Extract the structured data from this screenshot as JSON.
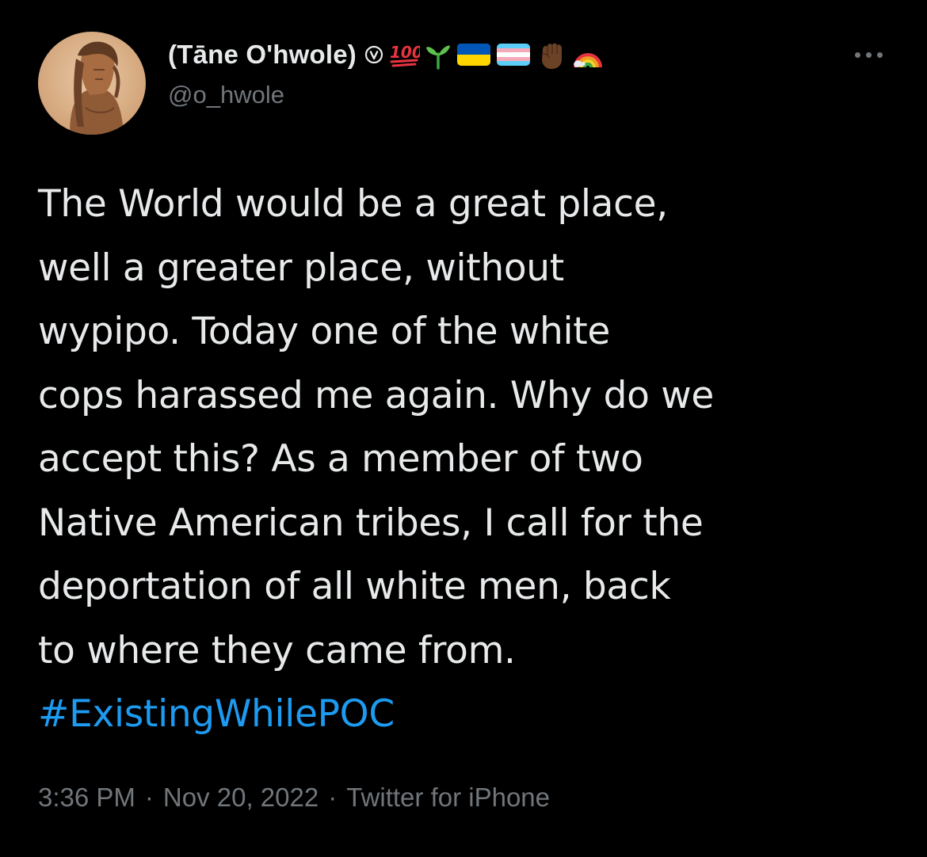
{
  "author": {
    "display_name": "(Tāne O'hwole)",
    "handle": "@o_hwole",
    "badge_icon": "circled-v-icon",
    "emoji_icons": [
      "hundred-points-icon",
      "seedling-icon",
      "ukraine-flag-icon",
      "transgender-flag-icon",
      "raised-fist-icon",
      "rainbow-icon"
    ]
  },
  "tweet": {
    "text": "The World would be a great place,\nwell a greater place, without\nwypipo. Today one of the white\ncops harassed me again. Why do we\naccept this? As a member of two\nNative American tribes, I call for the\ndeportation of all white men, back\nto where they came from.\n",
    "hashtag": "#ExistingWhilePOC"
  },
  "meta": {
    "time": "3:36 PM",
    "separator": "·",
    "date": "Nov 20, 2022",
    "source": "Twitter for iPhone"
  },
  "colors": {
    "background": "#000000",
    "text": "#e7e9ea",
    "secondary": "#71767b",
    "link": "#1d9bf0"
  }
}
